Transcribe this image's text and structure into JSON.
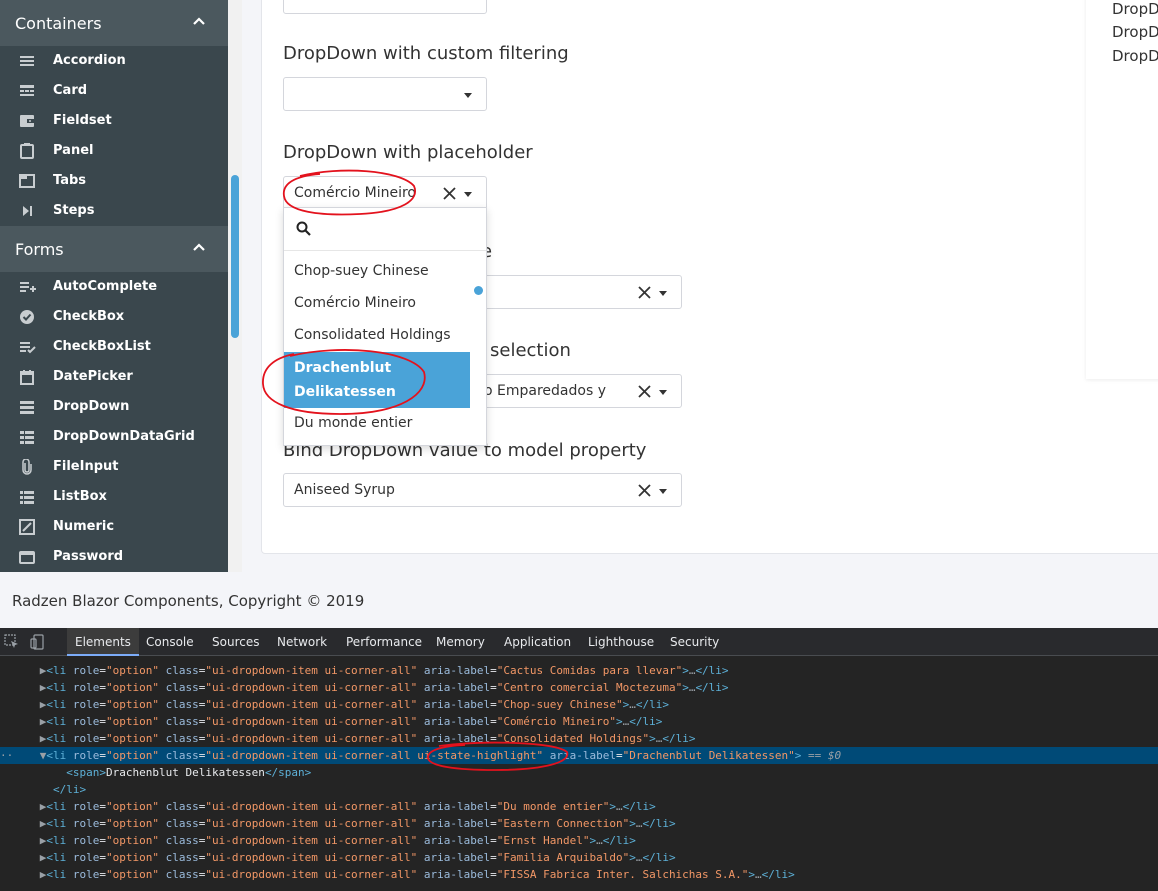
{
  "sidebar": {
    "sections": [
      {
        "title": "Containers",
        "items": [
          {
            "label": "Accordion",
            "icon": "list-icon"
          },
          {
            "label": "Card",
            "icon": "card-icon"
          },
          {
            "label": "Fieldset",
            "icon": "wallet-icon"
          },
          {
            "label": "Panel",
            "icon": "clipboard-icon"
          },
          {
            "label": "Tabs",
            "icon": "tab-icon"
          },
          {
            "label": "Steps",
            "icon": "skip-icon"
          }
        ]
      },
      {
        "title": "Forms",
        "items": [
          {
            "label": "AutoComplete",
            "icon": "playlist-add-icon"
          },
          {
            "label": "CheckBox",
            "icon": "check-circle-icon"
          },
          {
            "label": "CheckBoxList",
            "icon": "playlist-check-icon"
          },
          {
            "label": "DatePicker",
            "icon": "calendar-icon"
          },
          {
            "label": "DropDown",
            "icon": "storage-icon"
          },
          {
            "label": "DropDownDataGrid",
            "icon": "grid-icon"
          },
          {
            "label": "FileInput",
            "icon": "attach-icon"
          },
          {
            "label": "ListBox",
            "icon": "listbox-icon"
          },
          {
            "label": "Numeric",
            "icon": "numeric-icon"
          },
          {
            "label": "Password",
            "icon": "password-icon"
          }
        ]
      }
    ]
  },
  "main": {
    "headings": {
      "custom_filtering": "DropDown with custom filtering",
      "placeholder": "DropDown with placeholder",
      "hidden_partial": "e",
      "selection_partial": "selection",
      "bind": "Bind DropDown value to model property"
    },
    "dropdowns": {
      "placeholder_value": "Comércio Mineiro",
      "second_value": "",
      "third_value": "o Emparedados y",
      "bind_value": "Aniseed Syrup"
    },
    "popup": {
      "options": [
        "Chop-suey Chinese",
        "Comércio Mineiro",
        "Consolidated Holdings",
        "Drachenblut Delikatessen",
        "Du monde entier"
      ],
      "highlighted_index": 3,
      "highlighted_lines": [
        "Drachenblut",
        "Delikatessen"
      ]
    },
    "right_links": [
      "DropDo",
      "DropDo",
      "DropDo"
    ]
  },
  "footer": {
    "text": "Radzen Blazor Components, Copyright © 2019"
  },
  "devtools": {
    "tabs": [
      "Elements",
      "Console",
      "Sources",
      "Network",
      "Performance",
      "Memory",
      "Application",
      "Lighthouse",
      "Security"
    ],
    "active_tab": "Elements",
    "items": [
      "Cactus Comidas para llevar",
      "Centro comercial Moctezuma",
      "Chop-suey Chinese",
      "Comércio Mineiro",
      "Consolidated Holdings",
      "Drachenblut Delikatessen",
      "Du monde entier",
      "Eastern Connection",
      "Ernst Handel",
      "Familia Arquibaldo",
      "FISSA Fabrica Inter. Salchichas S.A."
    ],
    "code": {
      "li_open": "<li ",
      "role_attr": "role",
      "role_val": "\"option\"",
      "class_attr": "class",
      "class_val": "\"ui-dropdown-item ui-corner-all\"",
      "class_val_sel_a": "\"ui-dropdown-item ui-corner-all ",
      "class_val_sel_b": "ui-state-highlight\"",
      "aria_attr": "aria-label",
      "li_close": "</li>",
      "span_open": "<span>",
      "span_close": "</span>",
      "selected_hint": "== $0"
    }
  },
  "colors": {
    "accent": "#4aa3d8",
    "sidebar": "#3a474d",
    "annotation": "#e3121d"
  }
}
